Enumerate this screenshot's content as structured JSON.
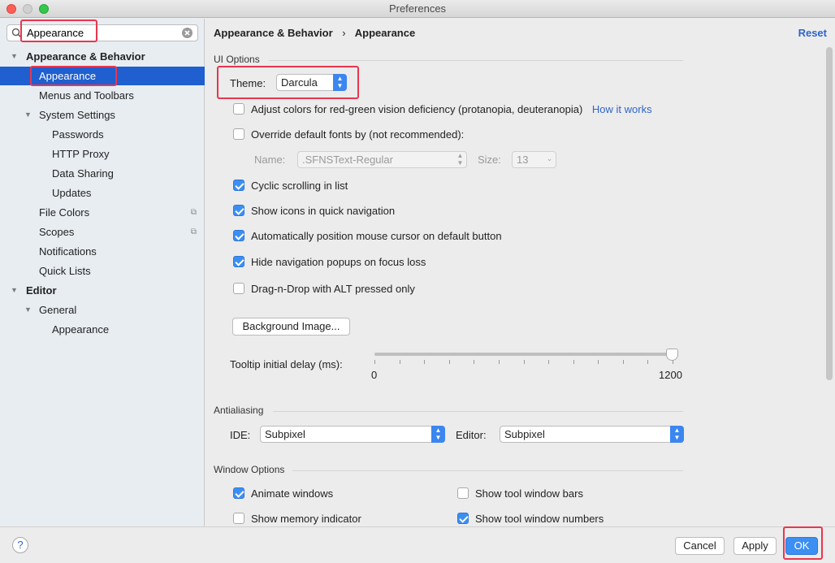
{
  "window": {
    "title": "Preferences"
  },
  "search": {
    "value": "Appearance"
  },
  "sidebar": {
    "items": [
      {
        "label": "Appearance & Behavior"
      },
      {
        "label": "Appearance"
      },
      {
        "label": "Menus and Toolbars"
      },
      {
        "label": "System Settings"
      },
      {
        "label": "Passwords"
      },
      {
        "label": "HTTP Proxy"
      },
      {
        "label": "Data Sharing"
      },
      {
        "label": "Updates"
      },
      {
        "label": "File Colors"
      },
      {
        "label": "Scopes"
      },
      {
        "label": "Notifications"
      },
      {
        "label": "Quick Lists"
      },
      {
        "label": "Editor"
      },
      {
        "label": "General"
      },
      {
        "label": "Appearance"
      }
    ]
  },
  "header": {
    "crumb1": "Appearance & Behavior",
    "separator": "›",
    "crumb2": "Appearance",
    "reset": "Reset"
  },
  "ui_options": {
    "section_title": "UI Options",
    "theme_label": "Theme:",
    "theme_value": "Darcula",
    "adjust_colors": {
      "label": "Adjust colors for red-green vision deficiency (protanopia, deuteranopia)",
      "checked": false
    },
    "how_it_works": "How it works",
    "override_fonts": {
      "label": "Override default fonts by (not recommended):",
      "checked": false
    },
    "font_name_label": "Name:",
    "font_name_value": ".SFNSText-Regular",
    "font_size_label": "Size:",
    "font_size_value": "13",
    "cyclic_scrolling": {
      "label": "Cyclic scrolling in list",
      "checked": true
    },
    "show_icons": {
      "label": "Show icons in quick navigation",
      "checked": true
    },
    "auto_position": {
      "label": "Automatically position mouse cursor on default button",
      "checked": true
    },
    "hide_popups": {
      "label": "Hide navigation popups on focus loss",
      "checked": true
    },
    "drag_drop": {
      "label": "Drag-n-Drop with ALT pressed only",
      "checked": false
    },
    "background_image": "Background Image...",
    "tooltip_label": "Tooltip initial delay (ms):",
    "tooltip_min": "0",
    "tooltip_max": "1200",
    "tooltip_value": 1200
  },
  "antialiasing": {
    "section_title": "Antialiasing",
    "ide_label": "IDE:",
    "ide_value": "Subpixel",
    "editor_label": "Editor:",
    "editor_value": "Subpixel"
  },
  "window_options": {
    "section_title": "Window Options",
    "animate_windows": {
      "label": "Animate windows",
      "checked": true
    },
    "show_tool_window_bars": {
      "label": "Show tool window bars",
      "checked": false
    },
    "show_memory_indicator": {
      "label": "Show memory indicator",
      "checked": false
    },
    "show_tool_window_numbers": {
      "label": "Show tool window numbers",
      "checked": true
    }
  },
  "footer": {
    "help": "?",
    "cancel": "Cancel",
    "apply": "Apply",
    "ok": "OK"
  },
  "colors": {
    "accent": "#3c8ff2",
    "selection": "#1f5fcf",
    "highlight": "#e8364f",
    "link": "#2f65ca"
  }
}
